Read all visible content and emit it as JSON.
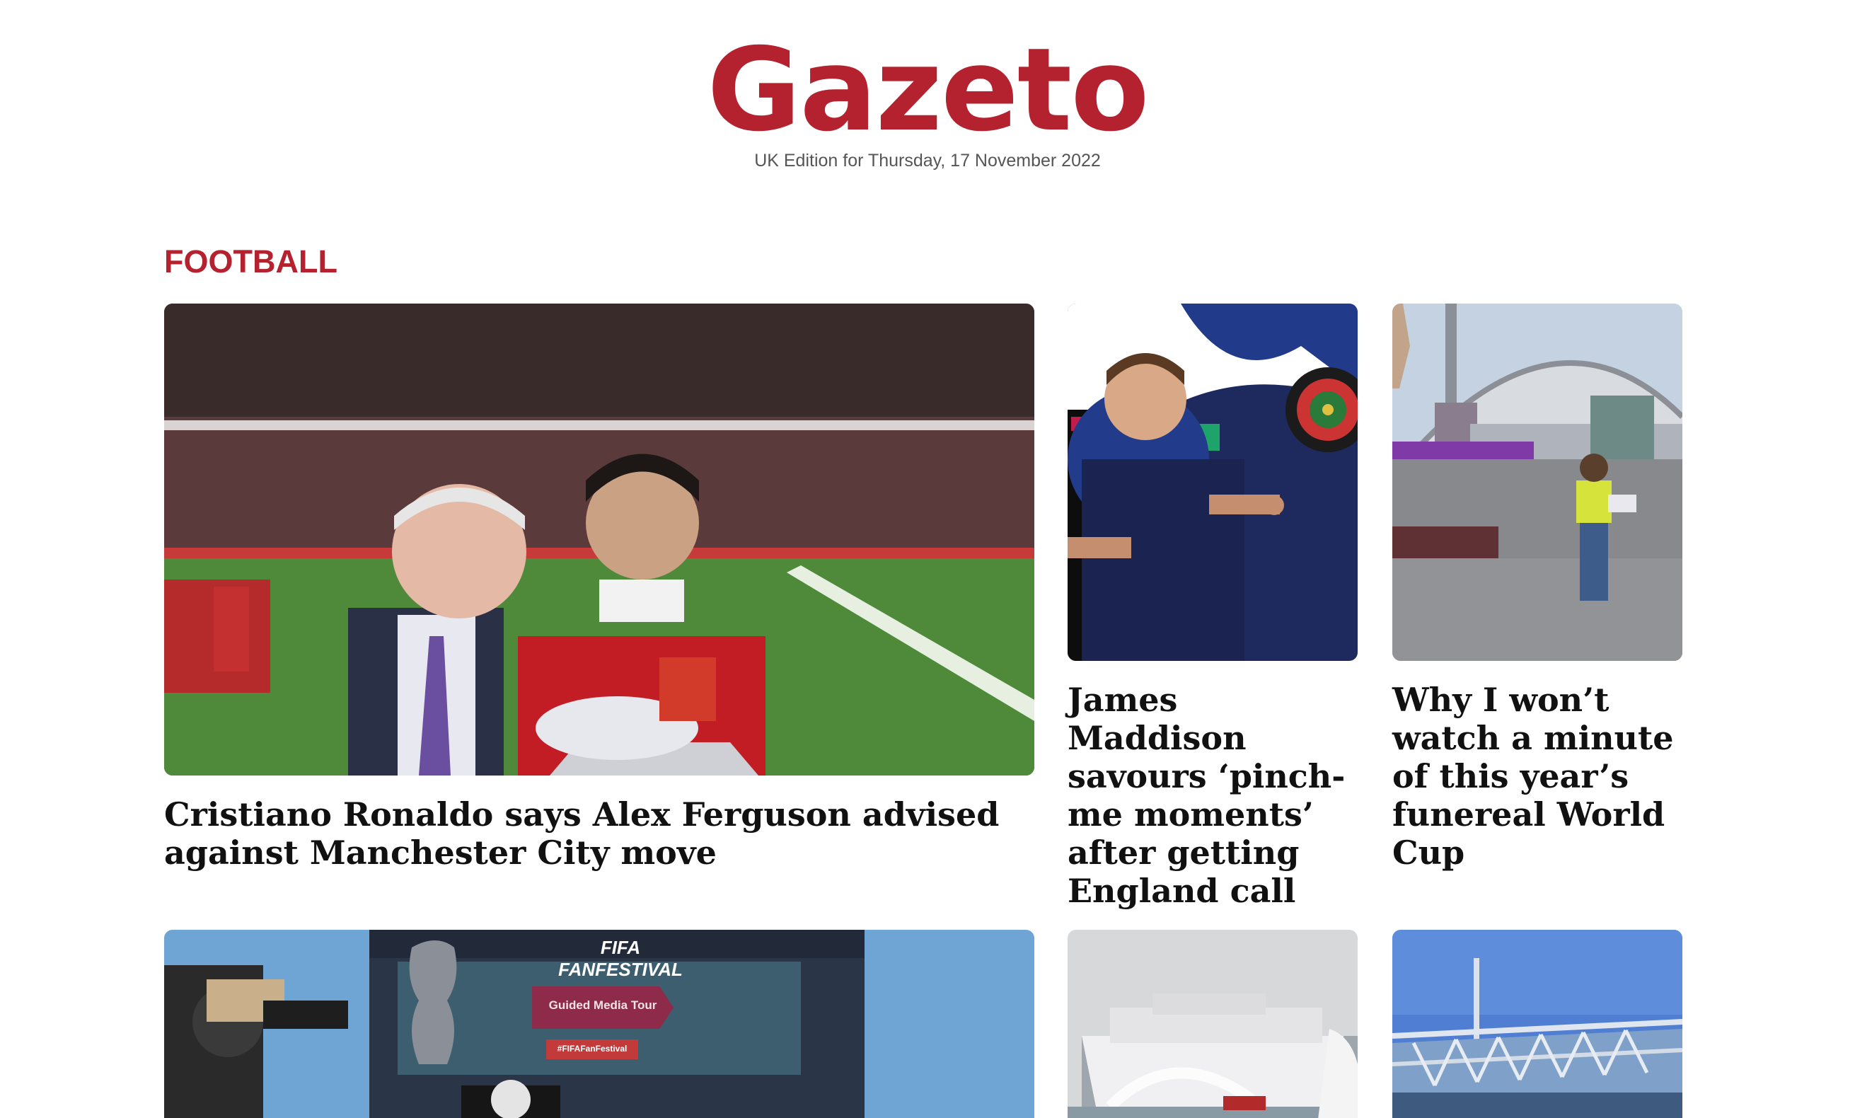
{
  "masthead": {
    "brand": "Gazeto",
    "edition": "UK Edition for Thursday, 17 November 2022"
  },
  "section": {
    "title": "FOOTBALL"
  },
  "articles": [
    {
      "headline": "Cristiano Ronaldo says Alex Ferguson advised against Manchester City move",
      "image": "ronaldo-ferguson-photo"
    },
    {
      "headline": "James Maddison savours ‘pinch-me moments’ after getting England call",
      "image": "maddison-darts-photo"
    },
    {
      "headline": "Why I won’t watch a minute of this year’s funereal World Cup",
      "image": "qatar-stadium-photo"
    },
    {
      "headline": "",
      "image": "fan-festival-photo",
      "image_text": {
        "banner": "FIFA FANFESTIVAL",
        "tour": "Guided Media Tour",
        "hashtag": "#FIFAFanFestival"
      }
    },
    {
      "headline": "",
      "image": "cruise-ship-photo"
    },
    {
      "headline": "",
      "image": "stadium-construction-photo"
    }
  ],
  "colors": {
    "brand": "#b3222e",
    "text": "#111111",
    "muted": "#555555"
  }
}
